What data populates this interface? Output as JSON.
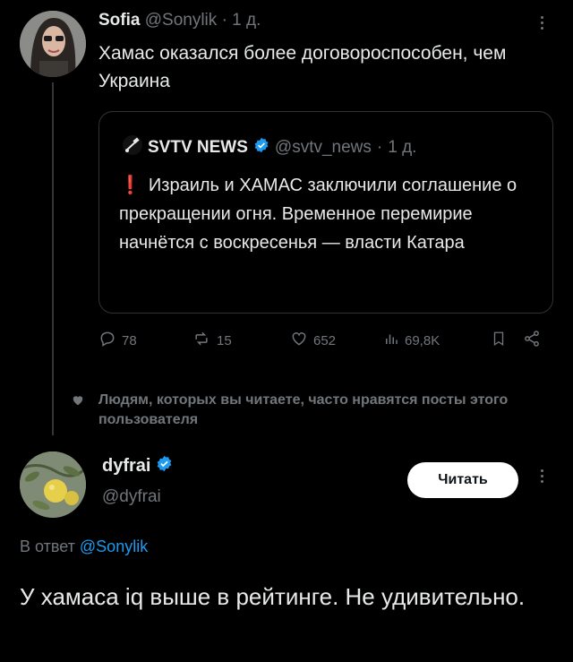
{
  "original_tweet": {
    "author_name": "Sofia",
    "author_handle": "@Sonylik",
    "time": "1 д.",
    "text": "Хамас оказался более договороспособен, чем Украина",
    "quote": {
      "author_name": "SVTV NEWS",
      "author_handle": "@svtv_news",
      "time": "1 д.",
      "text": "Израиль и ХАМАС заключили соглашение о прекращении огня. Временное перемирие начнётся с воскресенья — власти Катара"
    },
    "stats": {
      "replies": "78",
      "reposts": "15",
      "likes": "652",
      "views": "69,8K"
    }
  },
  "social_context": "Людям, которых вы читаете, часто нравятся посты этого пользователя",
  "reply_tweet": {
    "author_name": "dyfrai",
    "author_handle": "@dyfrai",
    "follow_label": "Читать",
    "reply_prefix": "В ответ",
    "reply_handle": "@Sonylik",
    "text": "У хамаса iq выше в рейтинге. Не удивительно."
  },
  "colors": {
    "background": "#000000",
    "text": "#e7e9ea",
    "muted": "#71767b",
    "link": "#1d9bf0",
    "verified": "#1d9bf0",
    "alert": "#f4212e",
    "border": "#2f3336"
  },
  "icons": [
    "reply-icon",
    "repost-icon",
    "like-icon",
    "views-icon",
    "bookmark-icon",
    "share-icon",
    "verified-badge-icon",
    "more-icon",
    "heart-icon",
    "satellite-logo-icon"
  ]
}
